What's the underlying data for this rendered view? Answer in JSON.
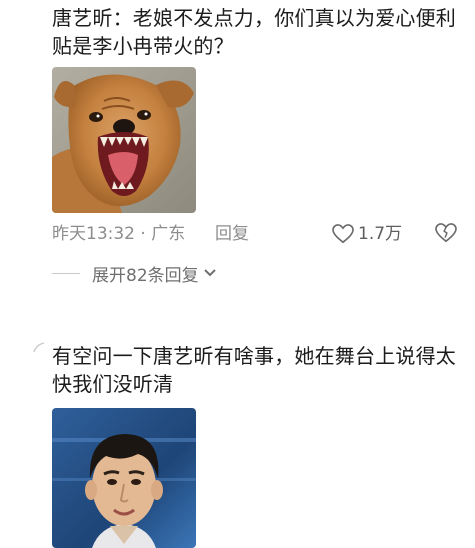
{
  "comments": [
    {
      "text": "唐艺昕：老娘不发点力，你们真以为爱心便利贴是李小冉带火的？",
      "time_location": "昨天13:32 · 广东",
      "reply_label": "回复",
      "likes": "1.7万",
      "expand_label": "展开82条回复",
      "image_icon": "snarling-dog-photo"
    },
    {
      "text": "有空问一下唐艺昕有啥事，她在舞台上说得太快我们没听清",
      "image_icon": "man-portrait-photo"
    }
  ],
  "colors": {
    "text": "#1c1c1c",
    "meta": "#8d8d8d",
    "background": "#ffffff"
  }
}
